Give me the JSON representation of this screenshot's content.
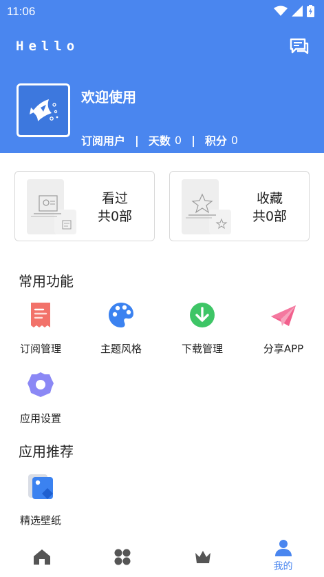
{
  "status_bar": {
    "time": "11:06"
  },
  "header": {
    "app_title": "Hello",
    "welcome": "欢迎使用",
    "stats": {
      "user_type": "订阅用户",
      "days_label": "天数",
      "days_value": "0",
      "points_label": "积分",
      "points_value": "0"
    }
  },
  "cards": [
    {
      "title": "看过",
      "count": "共0部"
    },
    {
      "title": "收藏",
      "count": "共0部"
    }
  ],
  "common_functions": {
    "title": "常用功能",
    "items": [
      {
        "label": "订阅管理",
        "icon": "document-icon",
        "color": "#f2726a"
      },
      {
        "label": "主题风格",
        "icon": "palette-icon",
        "color": "#3b82f0"
      },
      {
        "label": "下载管理",
        "icon": "download-icon",
        "color": "#3ec566"
      },
      {
        "label": "分享APP",
        "icon": "paper-plane-icon",
        "color": "#f2608d"
      },
      {
        "label": "应用设置",
        "icon": "gear-icon",
        "color": "#8b88f5"
      }
    ]
  },
  "app_recommend": {
    "title": "应用推荐",
    "items": [
      {
        "label": "精选壁纸",
        "icon": "wallpaper-icon",
        "color": "#3b82f0"
      }
    ]
  },
  "bottom_nav": {
    "items": [
      {
        "icon": "home-icon"
      },
      {
        "icon": "grid-icon"
      },
      {
        "icon": "crown-icon"
      },
      {
        "icon": "user-icon",
        "label": "我的",
        "active": true
      }
    ],
    "active_color": "#4a86ef",
    "inactive_color": "#555555"
  },
  "theme": {
    "primary": "#4a86ef"
  }
}
